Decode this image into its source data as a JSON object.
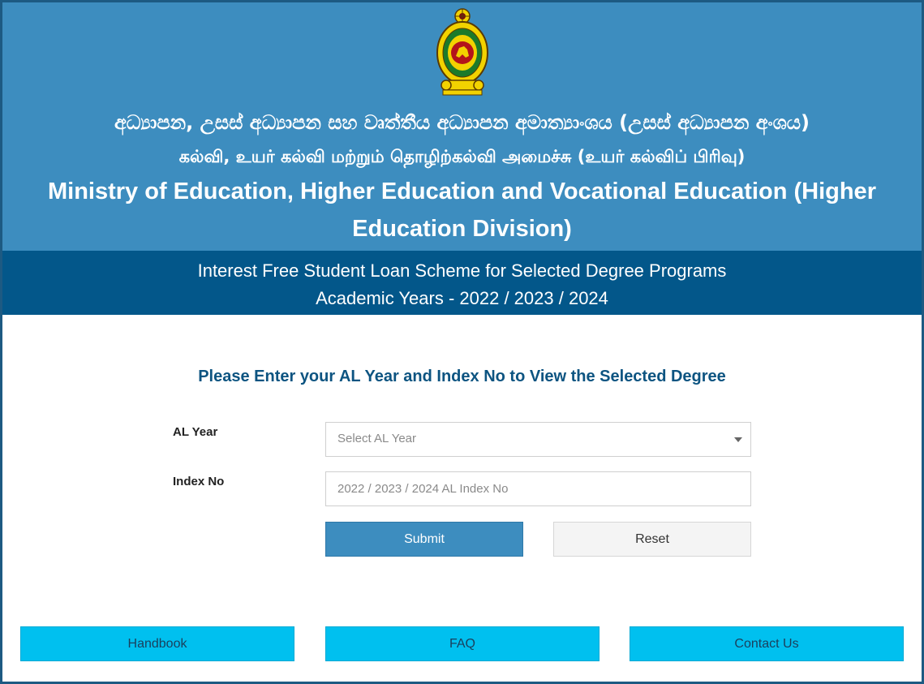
{
  "header": {
    "sinhala_title": "අධ්‍යාපන, උසස් අධ්‍යාපන සහ වෘත්තීය අධ්‍යාපන අමාත්‍යාංශය (උසස් අධ්‍යාපන අංශය)",
    "tamil_title": "கல்வி, உயர் கல்வி மற்றும் தொழிற்கல்வி அமைச்சு (உயர் கல்விப் பிரிவு)",
    "english_title": "Ministry of Education, Higher Education and Vocational Education (Higher Education Division)",
    "emblem_icon": "sri-lanka-emblem-icon"
  },
  "sub_banner": {
    "line1": "Interest Free Student Loan Scheme for Selected Degree Programs",
    "line2": "Academic Years - 2022 / 2023 / 2024"
  },
  "form": {
    "heading": "Please Enter your AL Year and Index No to View the Selected Degree",
    "al_year_label": "AL Year",
    "al_year_placeholder": "Select AL Year",
    "index_label": "Index No",
    "index_placeholder": "2022 / 2023 / 2024 AL Index No",
    "submit_label": "Submit",
    "reset_label": "Reset"
  },
  "footer": {
    "handbook_label": "Handbook",
    "faq_label": "FAQ",
    "contact_label": "Contact Us"
  },
  "colors": {
    "banner": "#3d8dbf",
    "sub_banner": "#03578a",
    "heading_text": "#0d5481",
    "link_buttons": "#00c0ef"
  }
}
